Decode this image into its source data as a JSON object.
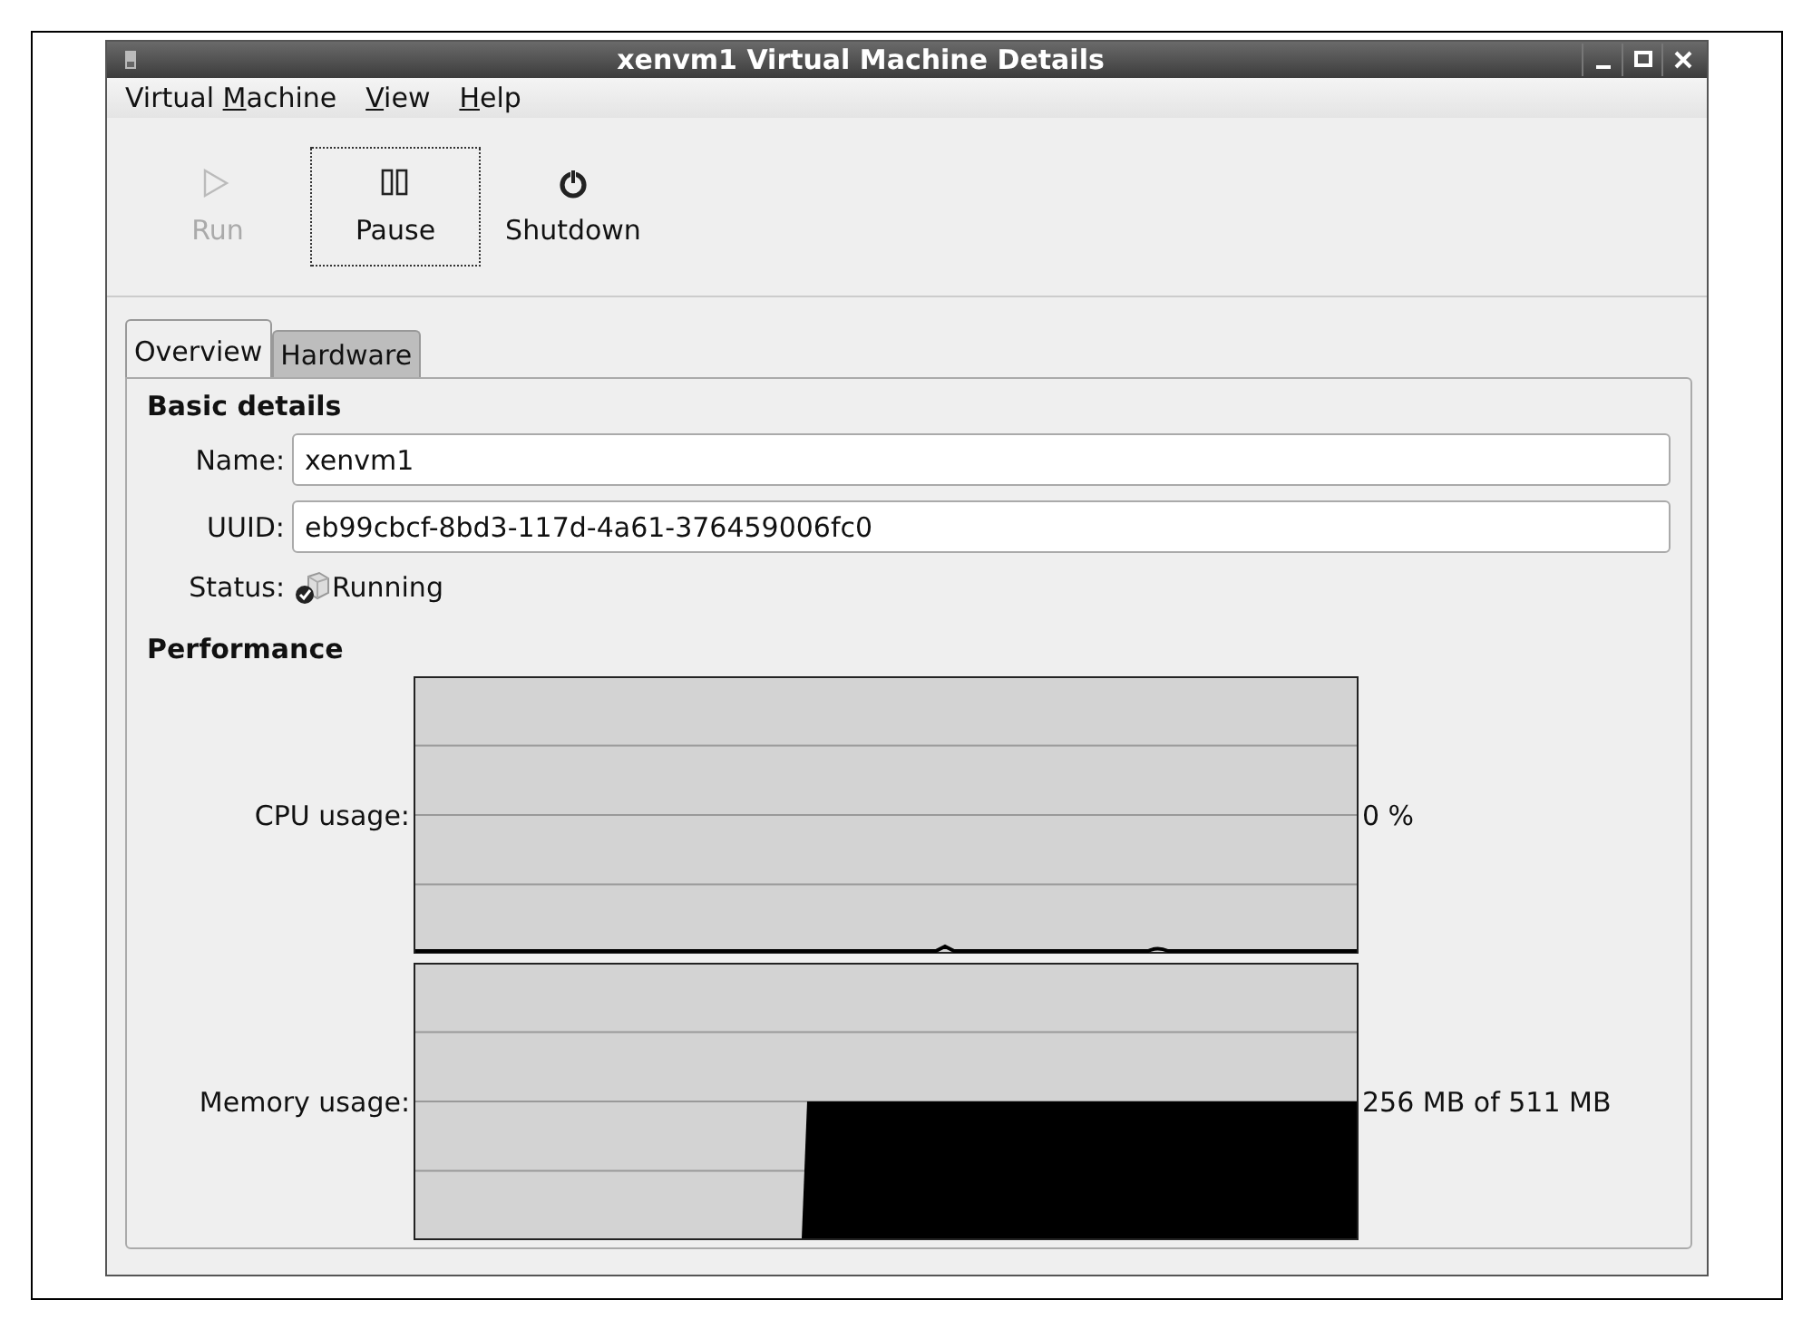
{
  "window": {
    "title": "xenvm1 Virtual Machine Details"
  },
  "menu": [
    {
      "before": "Virtual ",
      "mnemonic": "M",
      "after": "achine"
    },
    {
      "mnemonic": "V",
      "after": "iew"
    },
    {
      "mnemonic": "H",
      "after": "elp"
    }
  ],
  "toolbar": [
    {
      "label": "Run",
      "kind": "run",
      "disabled": true,
      "focused": false
    },
    {
      "label": "Pause",
      "kind": "pause",
      "disabled": false,
      "focused": true
    },
    {
      "label": "Shutdown",
      "kind": "shutdown",
      "disabled": false,
      "focused": false
    }
  ],
  "tabs": [
    {
      "label": "Overview",
      "selected": true
    },
    {
      "label": "Hardware",
      "selected": false
    }
  ],
  "basic_details": {
    "heading": "Basic details",
    "fields": [
      {
        "label": "Name:",
        "value": "xenvm1"
      },
      {
        "label": "UUID:",
        "value": "eb99cbcf-8bd3-117d-4a61-376459006fc0"
      }
    ],
    "status": {
      "label": "Status:",
      "value": "Running"
    }
  },
  "performance": {
    "heading": "Performance",
    "graphs": [
      {
        "label": "CPU usage:",
        "reading": "0 %",
        "kind": "line"
      },
      {
        "label": "Memory usage:",
        "reading": "256 MB of 511 MB",
        "kind": "area"
      }
    ]
  }
}
